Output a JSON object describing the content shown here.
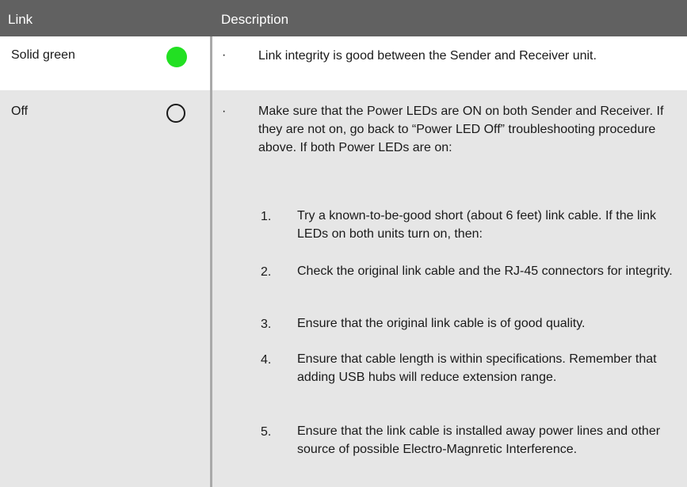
{
  "header": {
    "link": "Link",
    "description": "Description"
  },
  "rows": [
    {
      "link": "Solid green",
      "led": "green-led-icon",
      "bullet": "·",
      "description": "Link integrity is good between the Sender and Receiver unit."
    },
    {
      "link": "Off",
      "led": "off-led-icon",
      "bullet": "·",
      "description": "Make sure that the Power LEDs are ON on both Sender and Receiver. If they are not on, go back to “Power LED Off” troubleshooting procedure above. If both Power LEDs are on:",
      "steps": [
        {
          "num": "1.",
          "text": "Try a known-to-be-good short (about 6 feet) link cable. If the link LEDs on both units turn on, then:"
        },
        {
          "num": "2.",
          "text": "Check the original link cable and the RJ-45 connectors for integrity."
        },
        {
          "num": "3.",
          "text": "Ensure that the original link cable is of good quality."
        },
        {
          "num": "4.",
          "text": "Ensure that cable length is within specifications. Remember that adding USB hubs will reduce extension range."
        },
        {
          "num": "5.",
          "text": "Ensure that the link cable is installed away power lines and other source of possible Electro-Magnretic Interference."
        }
      ]
    }
  ],
  "colors": {
    "header_bg": "#616161",
    "row2_bg": "#e6e6e6",
    "led_green": "#22e022",
    "divider": "#a9a9a9"
  }
}
